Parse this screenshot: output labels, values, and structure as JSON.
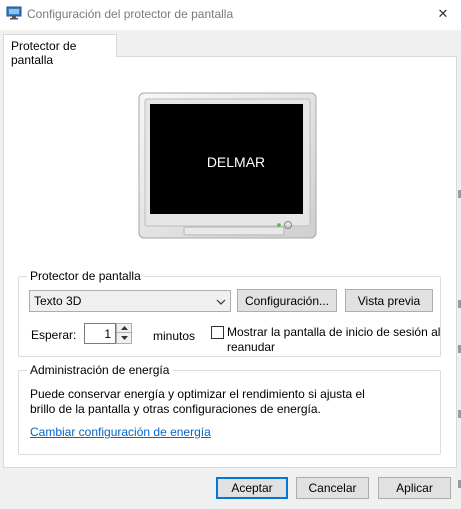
{
  "window": {
    "title": "Configuración del protector de pantalla",
    "close_glyph": "✕"
  },
  "tab": {
    "label": "Protector de pantalla"
  },
  "preview": {
    "text": "DELMAR"
  },
  "screensaver_group": {
    "legend": "Protector de pantalla",
    "selected": "Texto 3D",
    "settings_button": "Configuración...",
    "preview_button": "Vista previa",
    "wait_label": "Esperar:",
    "wait_value": "1",
    "wait_units": "minutos",
    "resume_checkbox_checked": false,
    "resume_label_line1": "Mostrar la pantalla de inicio de sesión al",
    "resume_label_line2": "reanudar"
  },
  "power_group": {
    "legend": "Administración de energía",
    "description_line1": "Puede conservar energía y optimizar el rendimiento si ajusta el",
    "description_line2": "brillo de la pantalla y otras configuraciones de energía.",
    "link": "Cambiar configuración de energía"
  },
  "footer": {
    "ok": "Aceptar",
    "cancel": "Cancelar",
    "apply": "Aplicar"
  },
  "colors": {
    "accent": "#0078d7",
    "link": "#0066cc",
    "preview_text": "#ffffff",
    "preview_screen": "#000000"
  }
}
